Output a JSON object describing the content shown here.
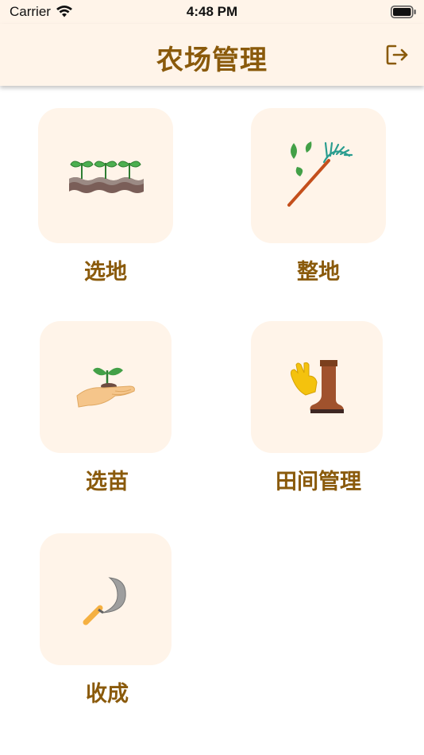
{
  "status_bar": {
    "carrier": "Carrier",
    "time": "4:48 PM",
    "wifi_icon": "wifi-icon",
    "battery_icon": "battery-full-icon"
  },
  "nav": {
    "title": "农场管理",
    "logout_icon": "logout-icon"
  },
  "menu": {
    "items": [
      {
        "label": "选地",
        "icon": "seedlings-soil-icon"
      },
      {
        "label": "整地",
        "icon": "rake-leaves-icon"
      },
      {
        "label": "选苗",
        "icon": "hand-sprout-icon"
      },
      {
        "label": "田间管理",
        "icon": "glove-boot-icon"
      },
      {
        "label": "收成",
        "icon": "sickle-icon"
      }
    ]
  },
  "colors": {
    "header_bg": "#fff4e9",
    "tile_bg": "#fff4e9",
    "accent_text": "#8a5a0b"
  }
}
